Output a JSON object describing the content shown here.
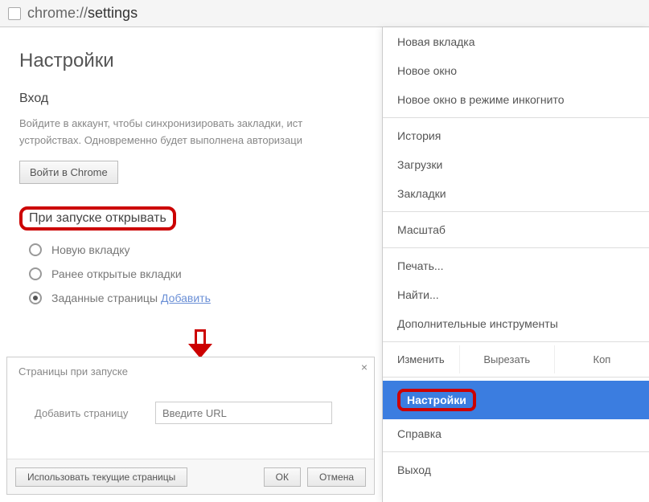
{
  "addressBar": {
    "scheme": "chrome://",
    "path": "settings"
  },
  "page": {
    "title": "Настройки"
  },
  "login": {
    "heading": "Вход",
    "helper": "Войдите в аккаунт, чтобы синхронизировать закладки, ист устройствах. Одновременно будет выполнена авторизаци",
    "button": "Войти в Chrome"
  },
  "startup": {
    "heading": "При запуске открывать",
    "opt_new_tab": "Новую вкладку",
    "opt_prev": "Ранее открытые вкладки",
    "opt_set": "Заданные страницы",
    "add_link": "Добавить"
  },
  "dialog": {
    "title": "Страницы при запуске",
    "add_label": "Добавить страницу",
    "placeholder": "Введите URL",
    "use_current": "Использовать текущие страницы",
    "ok": "ОК",
    "cancel": "Отмена"
  },
  "menu": {
    "new_tab": "Новая вкладка",
    "new_window": "Новое окно",
    "incognito": "Новое окно в режиме инкогнито",
    "history": "История",
    "downloads": "Загрузки",
    "bookmarks": "Закладки",
    "zoom": "Масштаб",
    "print": "Печать...",
    "find": "Найти...",
    "more_tools": "Дополнительные инструменты",
    "edit_label": "Изменить",
    "cut": "Вырезать",
    "copy": "Коп",
    "settings": "Настройки",
    "help": "Справка",
    "exit": "Выход"
  }
}
